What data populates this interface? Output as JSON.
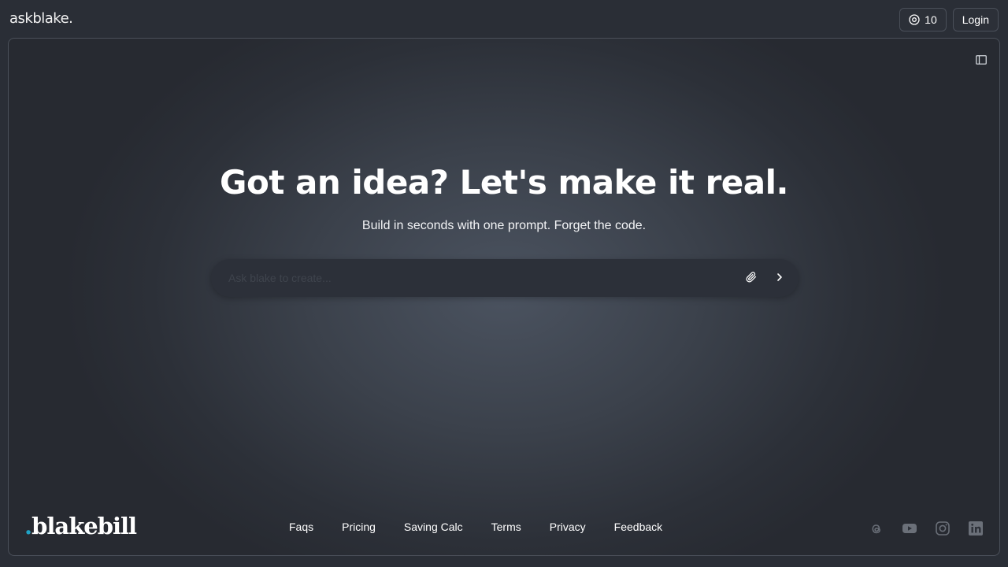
{
  "header": {
    "brand": "askblake.",
    "credits_count": "10",
    "login_label": "Login"
  },
  "hero": {
    "title": "Got an idea? Let's make it real.",
    "subtitle": "Build in seconds with one prompt. Forget the code."
  },
  "prompt": {
    "placeholder": "Ask blake to create..."
  },
  "footer": {
    "logo_dot": ".",
    "logo_text": "blakebill",
    "links": [
      "Faqs",
      "Pricing",
      "Saving Calc",
      "Terms",
      "Privacy",
      "Feedback"
    ],
    "social_icons": [
      "threads-icon",
      "youtube-icon",
      "instagram-icon",
      "linkedin-icon"
    ]
  },
  "colors": {
    "background": "#2a2e36",
    "accent_dot": "#1fa3c6",
    "social_icon": "#6b7079"
  }
}
